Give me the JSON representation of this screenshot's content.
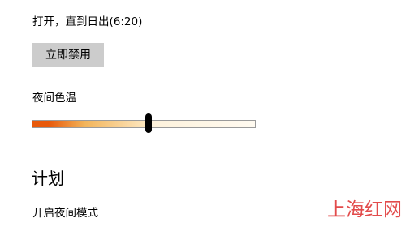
{
  "night_light": {
    "status_text": "打开，直到日出(6:20)",
    "disable_now_label": "立即禁用",
    "color_temperature_label": "夜间色温",
    "color_temperature_level": 0.52,
    "slider_colors": {
      "warm": "#e8590a",
      "mid": "#f2b45a",
      "light": "#fde9c4",
      "end": "#fffaf0"
    }
  },
  "schedule": {
    "title": "计划",
    "enable_label": "开启夜间模式"
  },
  "watermark": {
    "text": "上海红网",
    "color": "#e03c3c"
  }
}
